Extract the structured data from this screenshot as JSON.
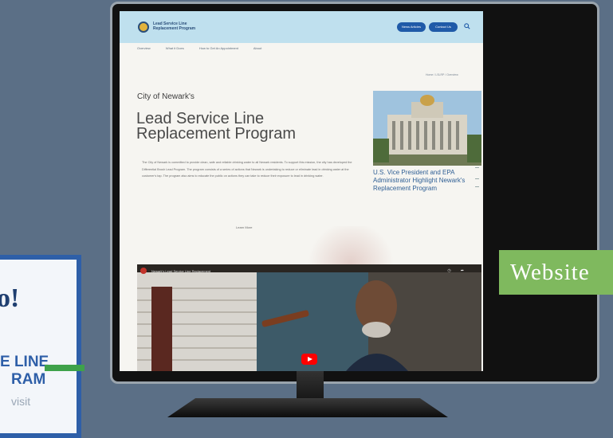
{
  "poster": {
    "headline": "o!",
    "line1": "E LINE",
    "line2": "RAM",
    "visit": "visit"
  },
  "site": {
    "logo_text_1": "Lead Service Line",
    "logo_text_2": "Replacement Program",
    "buttons": {
      "news": "News Articles",
      "contact": "Contact Us"
    },
    "nav": [
      "Overview",
      "What it Does",
      "How to Get An Appointment",
      "About"
    ],
    "breadcrumb": "Home / LSLRP / Overview"
  },
  "main": {
    "city_label": "City of Newark's",
    "headline_1": "Lead Service Line",
    "headline_2": "Replacement Program",
    "body": "The City of Newark is committed to provide clean, safe and reliable drinking water to all Newark residents. To support this mission, the city has developed the Differential Brush Lead Program. The program consists of a series of actions that Newark is undertaking to reduce or eliminate lead in drinking water at the customer's tap. The program also aims to educate the public on actions they can take to reduce their exposure to lead in drinking water.",
    "learn_more": "Learn More"
  },
  "sidebar": {
    "article_title": "U.S. Vice President and EPA Administrator Highlight Newark's Replacement Program",
    "date": "",
    "snippet": ""
  },
  "video": {
    "title": "Newark's Lead Service Line Replacement",
    "icons": [
      "clock-icon",
      "share-icon"
    ]
  },
  "overlay": {
    "label": "Website"
  },
  "colors": {
    "header_bg": "#bfe0ee",
    "brand_blue": "#1f5aa8",
    "banner_green": "#7fb95e",
    "link_blue": "#2f5f95"
  }
}
